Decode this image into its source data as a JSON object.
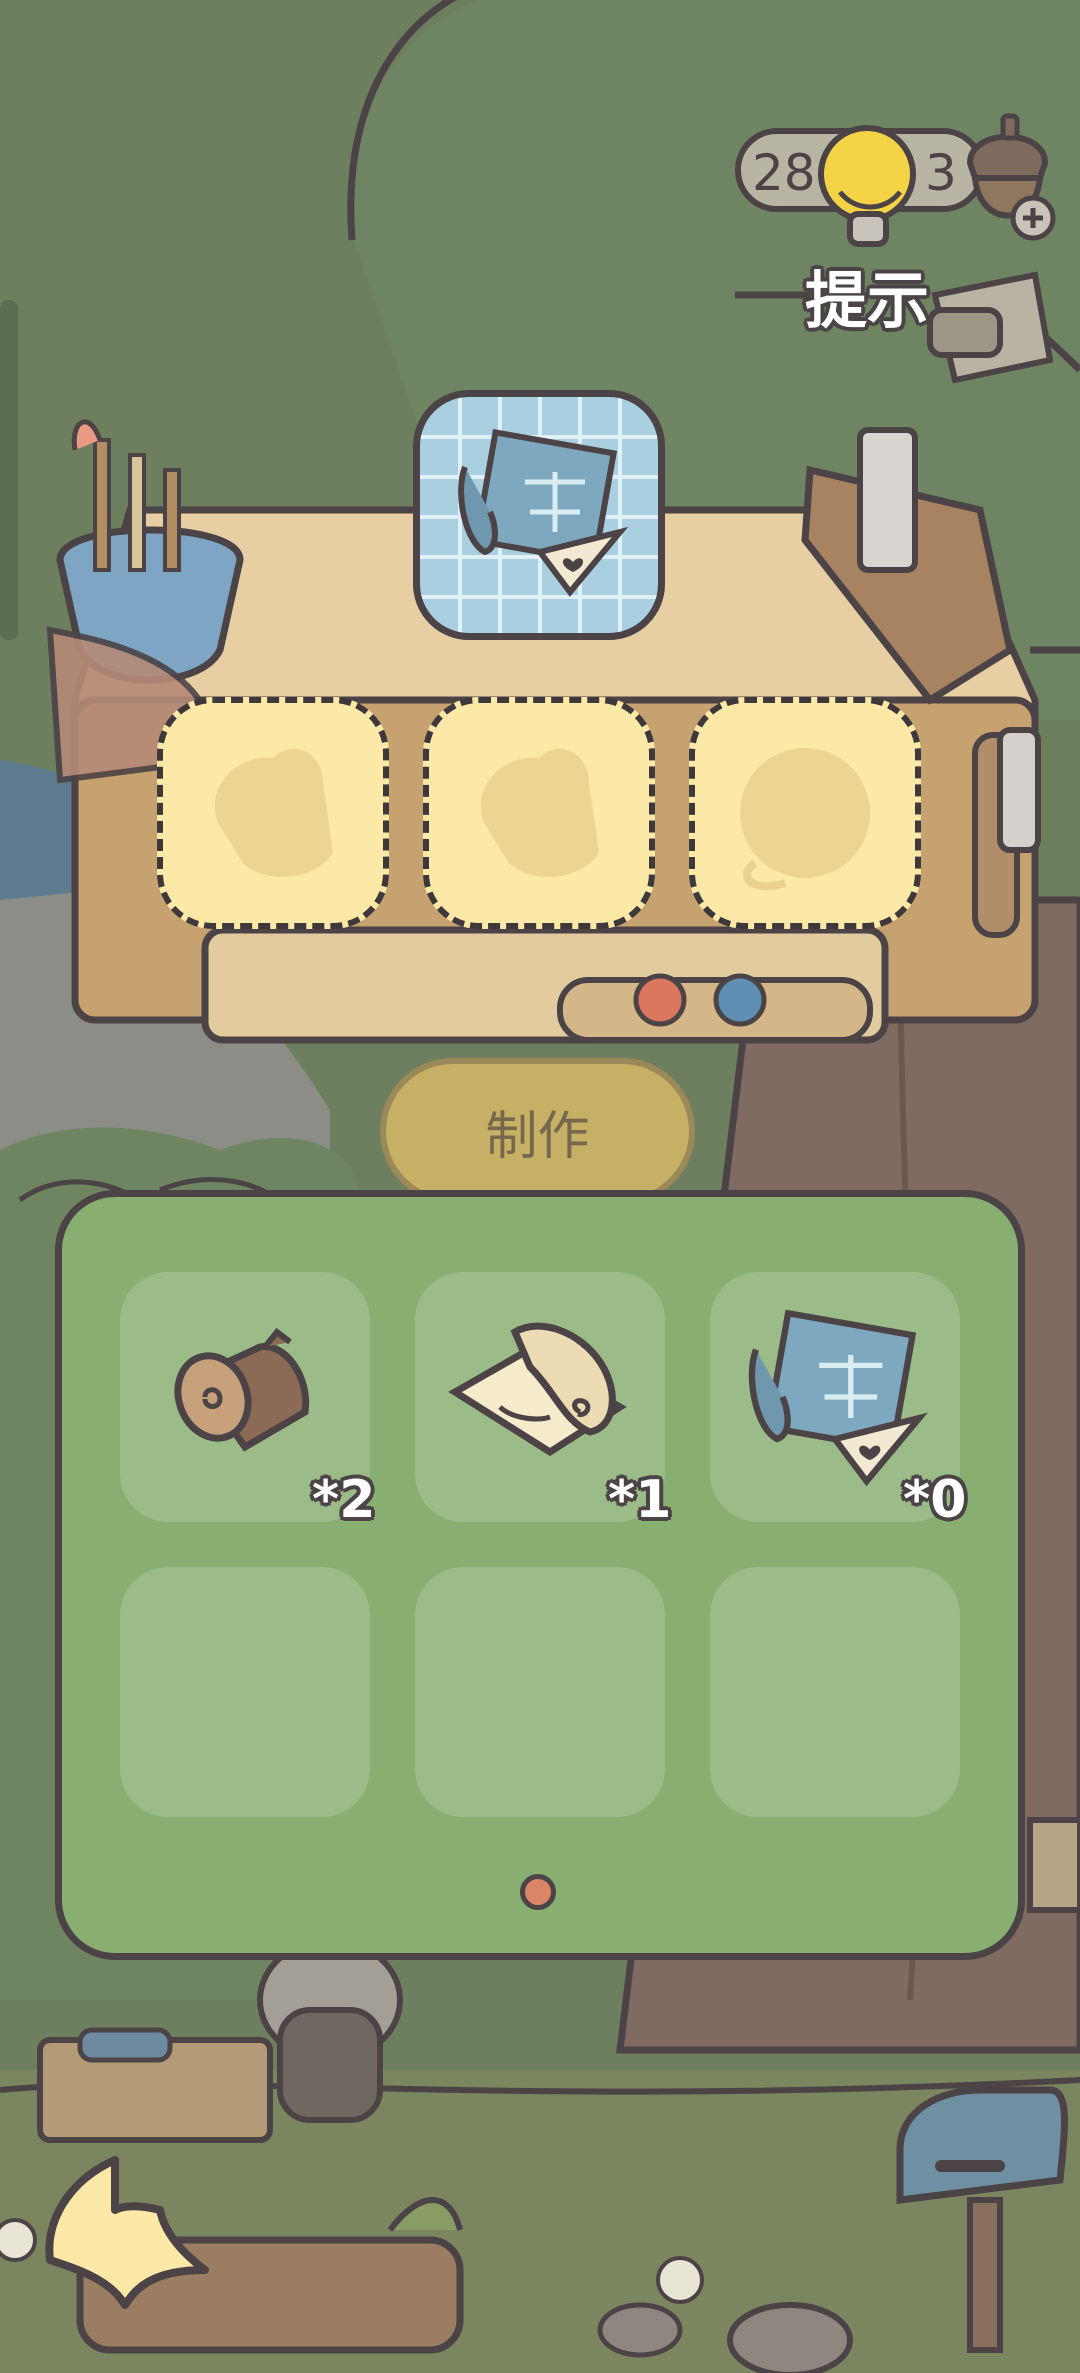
{
  "hud": {
    "hint_count": "28",
    "acorn_count": "3",
    "hint_label": "提示"
  },
  "craft": {
    "target_item": "blueprint-scroll",
    "ingredient_slots": [
      {
        "silhouette": "log",
        "filled": false
      },
      {
        "silhouette": "log",
        "filled": false
      },
      {
        "silhouette": "ball-of-string",
        "filled": false
      }
    ],
    "make_button_label": "制作",
    "make_button_enabled": false
  },
  "inventory": {
    "items": [
      {
        "name": "log",
        "count": "*2"
      },
      {
        "name": "paper-scroll",
        "count": "*1"
      },
      {
        "name": "blueprint-scroll",
        "count": "*0"
      }
    ],
    "empty_slots": 3,
    "page_indicator": {
      "current": 1,
      "total": 1
    }
  },
  "colors": {
    "panel_green": "#88ae72",
    "outline": "#4b4346",
    "slot_yellow": "#fce9a8",
    "make_button": "#e9c468",
    "page_dot": "#d98566"
  }
}
